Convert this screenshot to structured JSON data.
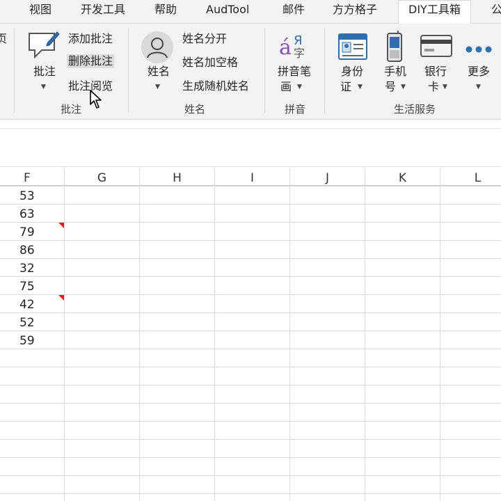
{
  "tabs": [
    {
      "label": "视图"
    },
    {
      "label": "开发工具"
    },
    {
      "label": "帮助"
    },
    {
      "label": "AudTool"
    },
    {
      "label": "邮件"
    },
    {
      "label": "方方格子"
    },
    {
      "label": "DIY工具箱",
      "active": true
    },
    {
      "label": "公"
    }
  ],
  "ribbon": {
    "comment_group": {
      "big_button": "批注",
      "add": "添加批注",
      "delete": "删除批注",
      "browse": "批注阅览",
      "label": "批注"
    },
    "name_group": {
      "big_button": "姓名",
      "split": "姓名分开",
      "add_space": "姓名加空格",
      "random": "生成随机姓名",
      "label": "姓名"
    },
    "pinyin_group": {
      "big_button_line1": "拼音笔",
      "big_button_line2": "画",
      "label": "拼音"
    },
    "life_group": {
      "id_line1": "身份",
      "id_line2": "证",
      "phone_line1": "手机",
      "phone_line2": "号",
      "bank_line1": "银行",
      "bank_line2": "卡",
      "more": "更多",
      "label": "生活服务"
    }
  },
  "grid": {
    "columns": [
      "F",
      "G",
      "H",
      "I",
      "J",
      "K",
      "L"
    ],
    "f_values": [
      "53",
      "63",
      "79",
      "86",
      "32",
      "75",
      "42",
      "52",
      "59"
    ],
    "comment_rows": [
      2,
      6
    ]
  },
  "colors": {
    "ribbon_bg": "#f3f3f3",
    "comment_indicator": "#e31b1b",
    "icon_blue": "#2f6fb0",
    "pinyin_purple": "#8a4fb5"
  }
}
